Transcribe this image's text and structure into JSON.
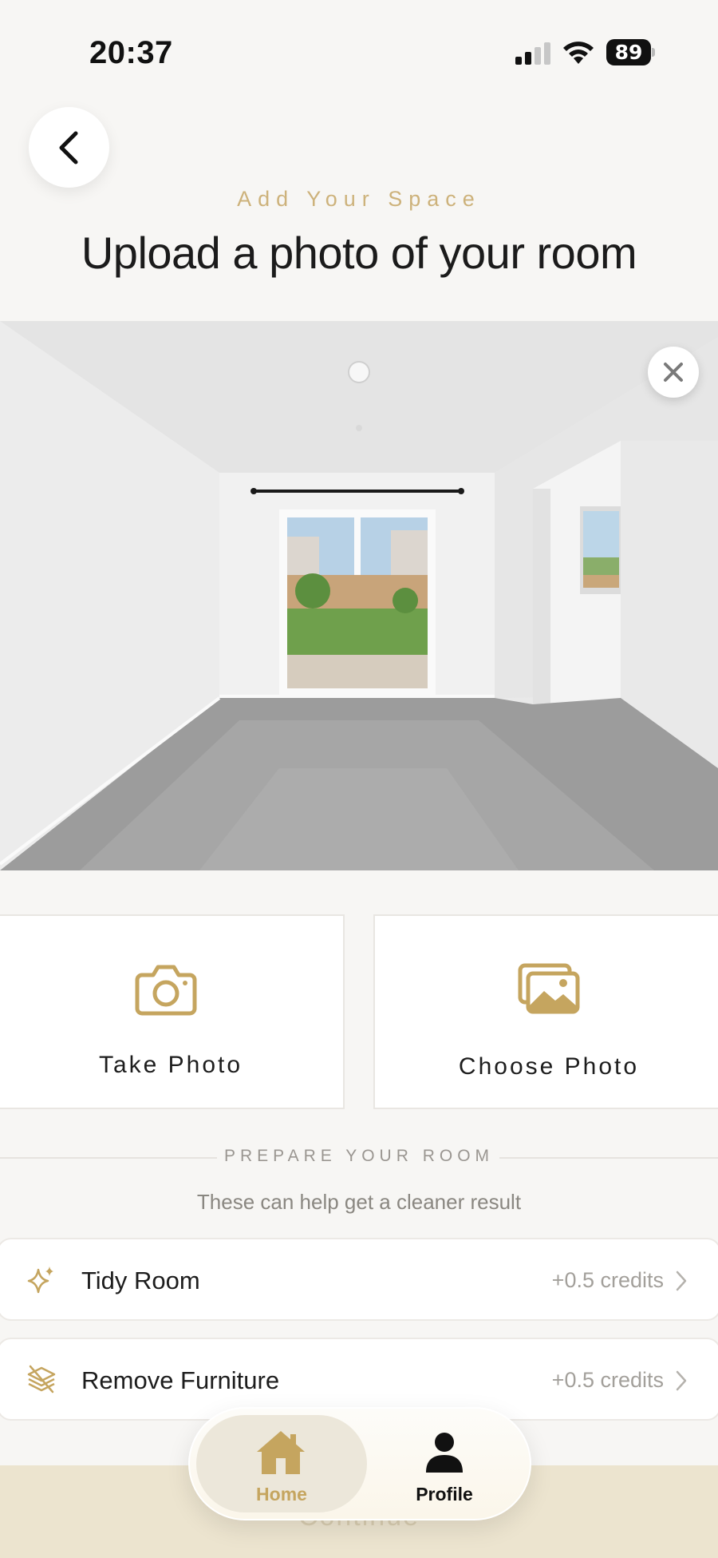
{
  "status_bar": {
    "time": "20:37",
    "battery": "89"
  },
  "header": {
    "eyebrow": "Add Your Space",
    "title": "Upload a photo of your room"
  },
  "upload": {
    "take_photo_label": "Take Photo",
    "choose_photo_label": "Choose Photo"
  },
  "prepare": {
    "heading": "PREPARE YOUR ROOM",
    "subtext": "These can help get a cleaner result",
    "options": [
      {
        "label": "Tidy Room",
        "credits": "+0.5 credits",
        "icon": "sparkle-icon"
      },
      {
        "label": "Remove Furniture",
        "credits": "+0.5 credits",
        "icon": "layers-off-icon"
      }
    ]
  },
  "footer": {
    "continue_label": "Continue"
  },
  "tabbar": {
    "items": [
      {
        "label": "Home",
        "icon": "home-icon",
        "active": true
      },
      {
        "label": "Profile",
        "icon": "person-icon",
        "active": false
      }
    ]
  },
  "colors": {
    "accent_gold": "#c5a55f",
    "background": "#f7f6f4",
    "card": "#ffffff"
  }
}
